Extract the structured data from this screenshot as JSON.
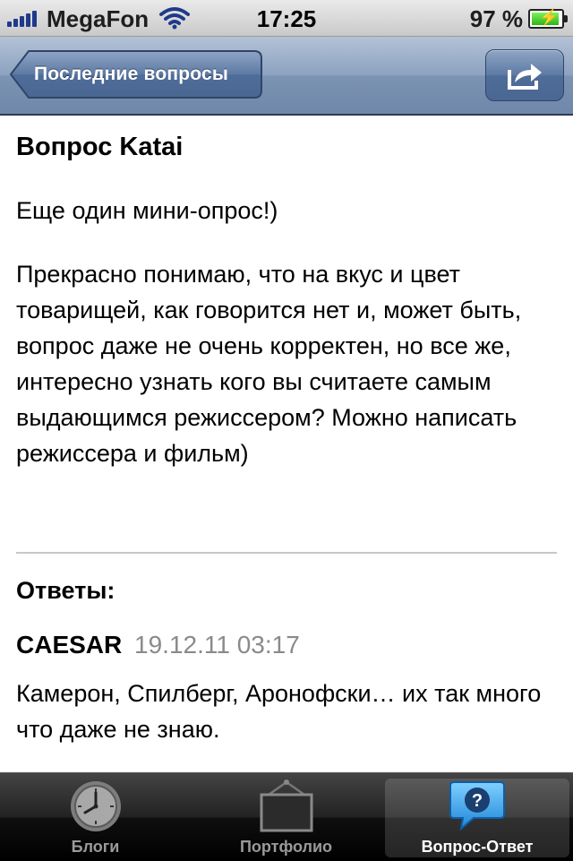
{
  "status_bar": {
    "carrier": "MegaFon",
    "time": "17:25",
    "battery": "97 %"
  },
  "nav": {
    "back_label": "Последние вопросы",
    "share_icon": "share-icon"
  },
  "question": {
    "title": "Вопрос Katai",
    "intro": "Еще один мини-опрос!)",
    "body": "Прекрасно понимаю, что на вкус и цвет товарищей, как говорится нет и, может быть, вопрос даже не очень корректен, но все же, интересно узнать кого вы считаете самым выдающимся режиссером? Можно написать режиссера и фильм)"
  },
  "answers": {
    "heading": "Ответы:",
    "items": [
      {
        "author": "CAESAR",
        "date": "19.12.11 03:17",
        "text": "Камерон, Спилберг, Аронофски… их так много что даже не знаю."
      }
    ]
  },
  "tabs": [
    {
      "label": "Блоги",
      "icon": "clock-icon",
      "active": false
    },
    {
      "label": "Портфолио",
      "icon": "frame-icon",
      "active": false
    },
    {
      "label": "Вопрос-Ответ",
      "icon": "question-bubble-icon",
      "active": true
    }
  ],
  "colors": {
    "navbar": "#7c93b3",
    "tab_active_label": "#ffffff",
    "date_gray": "#8a8a8a"
  }
}
